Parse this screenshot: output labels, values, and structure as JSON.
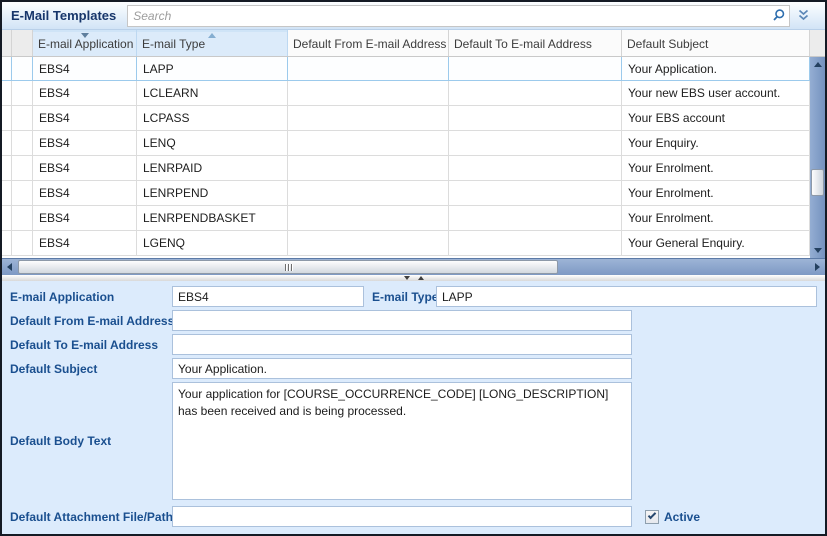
{
  "header": {
    "title": "E-Mail Templates",
    "search_placeholder": "Search"
  },
  "grid": {
    "columns": [
      {
        "label": "E-mail Application",
        "sort": "descending"
      },
      {
        "label": "E-mail Type",
        "sort": "ascending"
      },
      {
        "label": "Default From E-mail Address",
        "sort": "none"
      },
      {
        "label": "Default To E-mail Address",
        "sort": "none"
      },
      {
        "label": "Default Subject",
        "sort": "none"
      }
    ],
    "rows": [
      {
        "application": "EBS4",
        "type": "LAPP",
        "from": "",
        "to": "",
        "subject": "Your Application.",
        "selected": true
      },
      {
        "application": "EBS4",
        "type": "LCLEARN",
        "from": "",
        "to": "",
        "subject": "Your new EBS user account.",
        "selected": false
      },
      {
        "application": "EBS4",
        "type": "LCPASS",
        "from": "",
        "to": "",
        "subject": "Your EBS account",
        "selected": false
      },
      {
        "application": "EBS4",
        "type": "LENQ",
        "from": "",
        "to": "",
        "subject": "Your Enquiry.",
        "selected": false
      },
      {
        "application": "EBS4",
        "type": "LENRPAID",
        "from": "",
        "to": "",
        "subject": "Your Enrolment.",
        "selected": false
      },
      {
        "application": "EBS4",
        "type": "LENRPEND",
        "from": "",
        "to": "",
        "subject": "Your Enrolment.",
        "selected": false
      },
      {
        "application": "EBS4",
        "type": "LENRPENDBASKET",
        "from": "",
        "to": "",
        "subject": "Your Enrolment.",
        "selected": false
      },
      {
        "application": "EBS4",
        "type": "LGENQ",
        "from": "",
        "to": "",
        "subject": "Your General Enquiry.",
        "selected": false
      }
    ]
  },
  "form": {
    "fields": {
      "email_application": {
        "label": "E-mail Application",
        "value": "EBS4"
      },
      "email_type": {
        "label": "E-mail Type",
        "value": "LAPP"
      },
      "default_from": {
        "label": "Default From E-mail Address",
        "value": ""
      },
      "default_to": {
        "label": "Default To E-mail Address",
        "value": ""
      },
      "default_subject": {
        "label": "Default Subject",
        "value": "Your Application."
      },
      "default_body": {
        "label": "Default Body Text",
        "value": "Your application for [COURSE_OCCURRENCE_CODE] [LONG_DESCRIPTION] has been received and is being processed."
      },
      "default_attachment": {
        "label": "Default Attachment File/Path",
        "value": ""
      },
      "active": {
        "label": "Active",
        "checked": true
      }
    }
  },
  "colors": {
    "title_navy": "#17366b",
    "label_blue": "#1a4f8f",
    "form_background": "#dcebfc",
    "selected_row_border": "#9ccaec",
    "scrollbar_track": "#7e99c4",
    "search_icon_blue": "#2e6eae"
  }
}
